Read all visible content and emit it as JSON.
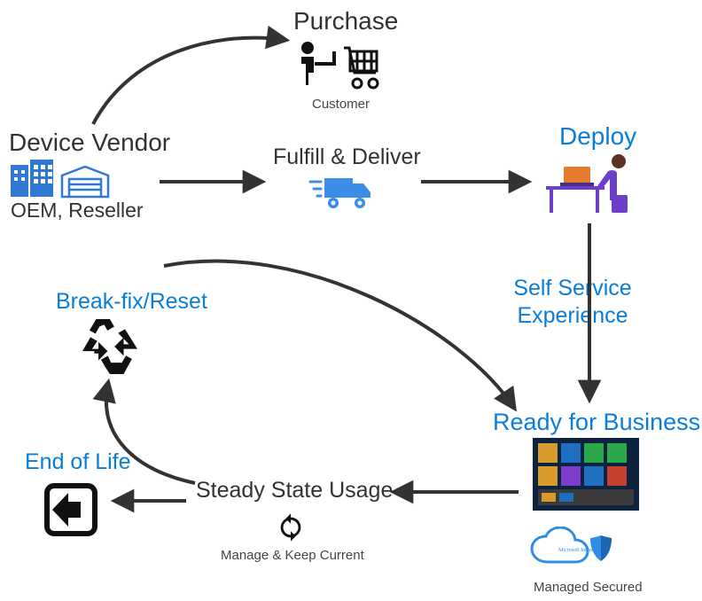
{
  "nodes": {
    "purchase": {
      "label": "Purchase",
      "caption": "Customer"
    },
    "device_vendor": {
      "label": "Device Vendor",
      "caption": "OEM, Reseller"
    },
    "fulfill": {
      "label": "Fulfill & Deliver"
    },
    "deploy": {
      "label": "Deploy"
    },
    "self_service": {
      "line1": "Self Service",
      "line2": "Experience"
    },
    "ready": {
      "label": "Ready for Business",
      "managed": "Managed Secured",
      "intune": "Microsoft Intune"
    },
    "steady": {
      "label": "Steady State Usage",
      "caption": "Manage & Keep Current"
    },
    "breakfix": {
      "label": "Break-fix/Reset"
    },
    "eol": {
      "label": "End of Life"
    }
  },
  "diagram": {
    "flow": [
      "Device Vendor → Purchase (Customer)",
      "Device Vendor → Fulfill & Deliver → Deploy",
      "Deploy → (Self Service Experience) → Ready for Business (Managed Secured)",
      "Ready for Business → Steady State Usage (Manage & Keep Current)",
      "Steady State Usage → End of Life",
      "Steady State Usage → Break-fix/Reset → Ready for Business"
    ]
  }
}
